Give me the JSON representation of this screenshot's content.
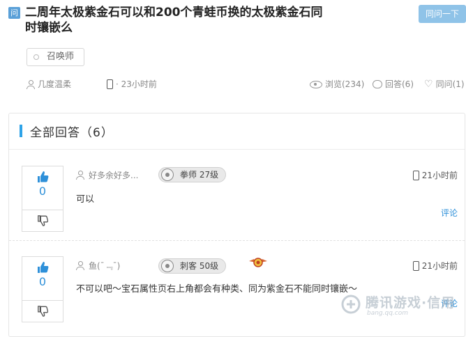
{
  "question": {
    "badge": "问",
    "title": "二周年太极紫金石可以和200个青蛙币换的太极紫金石同时镶嵌么",
    "ask_button": "同问一下",
    "tag": "召唤师",
    "author": "几度温柔",
    "time": "· 23小时前",
    "views": "浏览(234)",
    "answers": "回答(6)",
    "same_ask": "同问(1)"
  },
  "panel": {
    "title": "全部回答（6）"
  },
  "answers": [
    {
      "votes": "0",
      "user": "好多余好多...",
      "rank": "拳师 27级",
      "time": "21小时前",
      "text": "可以",
      "comment": "评论"
    },
    {
      "votes": "0",
      "user": "鱼(¯﹃¯)",
      "rank": "刺客 50级",
      "time": "21小时前",
      "text": "不可以吧～宝石属性页右上角都会有种类、同为紫金石不能同时镶嵌～",
      "comment": "评论"
    }
  ],
  "watermark": {
    "main": "腾讯游戏·信用",
    "sub": "bang.qq.com"
  },
  "colors": {
    "accent": "#2ea3e8",
    "ask_button_bg": "#8fc3e8",
    "vote_count": "#2e90d9"
  }
}
